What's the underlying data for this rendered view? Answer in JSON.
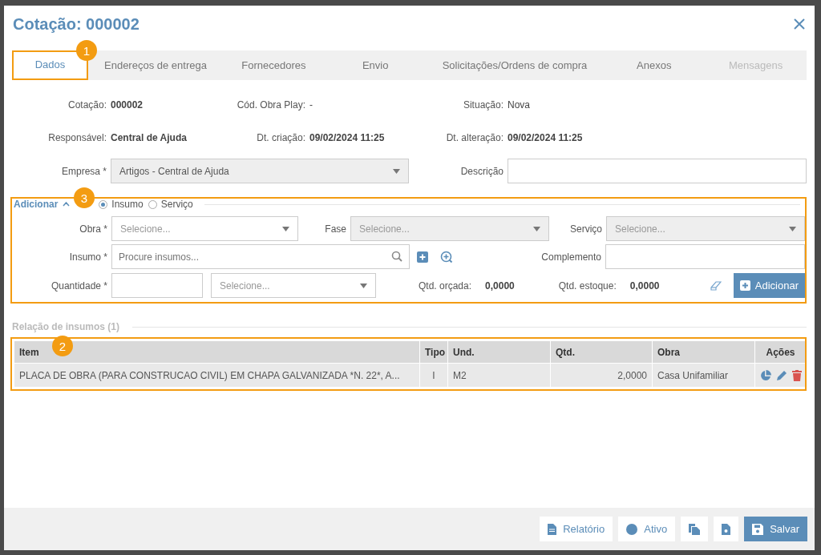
{
  "title": "Cotação: 000002",
  "tabs": [
    {
      "label": "Dados",
      "selected": true,
      "disabled": false,
      "annotation": "1"
    },
    {
      "label": "Endereços de entrega",
      "selected": false,
      "disabled": false
    },
    {
      "label": "Fornecedores",
      "selected": false,
      "disabled": false
    },
    {
      "label": "Envio",
      "selected": false,
      "disabled": false
    },
    {
      "label": "Solicitações/Ordens de compra",
      "selected": false,
      "disabled": false
    },
    {
      "label": "Anexos",
      "selected": false,
      "disabled": false
    },
    {
      "label": "Mensagens",
      "selected": false,
      "disabled": true
    }
  ],
  "info": [
    {
      "label": "Cotação:",
      "value": "000002",
      "bold": true
    },
    {
      "label": "Cód. Obra Play:",
      "value": "-",
      "bold": false
    },
    {
      "label": "Situação:",
      "value": "Nova",
      "bold": false
    },
    {
      "label": "Responsável:",
      "value": "Central de Ajuda",
      "bold": true
    },
    {
      "label": "Dt. criação:",
      "value": "09/02/2024 11:25",
      "bold": true
    },
    {
      "label": "Dt. alteração:",
      "value": "09/02/2024 11:25",
      "bold": true
    }
  ],
  "empresa": {
    "label": "Empresa *",
    "value": "Artigos - Central de Ajuda"
  },
  "descricao": {
    "label": "Descrição"
  },
  "add_section": {
    "title": "Adicionar",
    "annotation": "3",
    "radios": [
      {
        "label": "Insumo",
        "selected": true
      },
      {
        "label": "Serviço",
        "selected": false
      }
    ],
    "obra": {
      "label": "Obra *",
      "placeholder": "Selecione...",
      "disabled": false
    },
    "fase": {
      "label": "Fase",
      "placeholder": "Selecione...",
      "disabled": true
    },
    "servico": {
      "label": "Serviço",
      "placeholder": "Selecione...",
      "disabled": true
    },
    "insumo": {
      "label": "Insumo *",
      "placeholder": "Procure insumos..."
    },
    "complemento": {
      "label": "Complemento"
    },
    "quantidade": {
      "label": "Quantidade *"
    },
    "unidade": {
      "placeholder": "Selecione...",
      "disabled": false
    },
    "qtd_orcada": {
      "label": "Qtd. orçada:",
      "value": "0,0000"
    },
    "qtd_estoque": {
      "label": "Qtd. estoque:",
      "value": "0,0000"
    },
    "add_button": "Adicionar"
  },
  "items": {
    "title": "Relação de insumos (1)",
    "annotation": "2",
    "columns": [
      "Item",
      "Tipo",
      "Und.",
      "Qtd.",
      "Obra",
      "Ações"
    ],
    "rows": [
      [
        "PLACA DE OBRA (PARA CONSTRUCAO CIVIL) EM CHAPA GALVANIZADA *N. 22*, A...",
        "I",
        "M2",
        "2,0000",
        "Casa Unifamiliar"
      ]
    ]
  },
  "footer_buttons": [
    {
      "kind": "report",
      "label": "Relatório",
      "primary": false
    },
    {
      "kind": "status",
      "label": "Ativo",
      "primary": false
    },
    {
      "kind": "copy",
      "primary": false
    },
    {
      "kind": "import",
      "primary": false
    },
    {
      "kind": "save",
      "label": "Salvar",
      "primary": true
    }
  ]
}
